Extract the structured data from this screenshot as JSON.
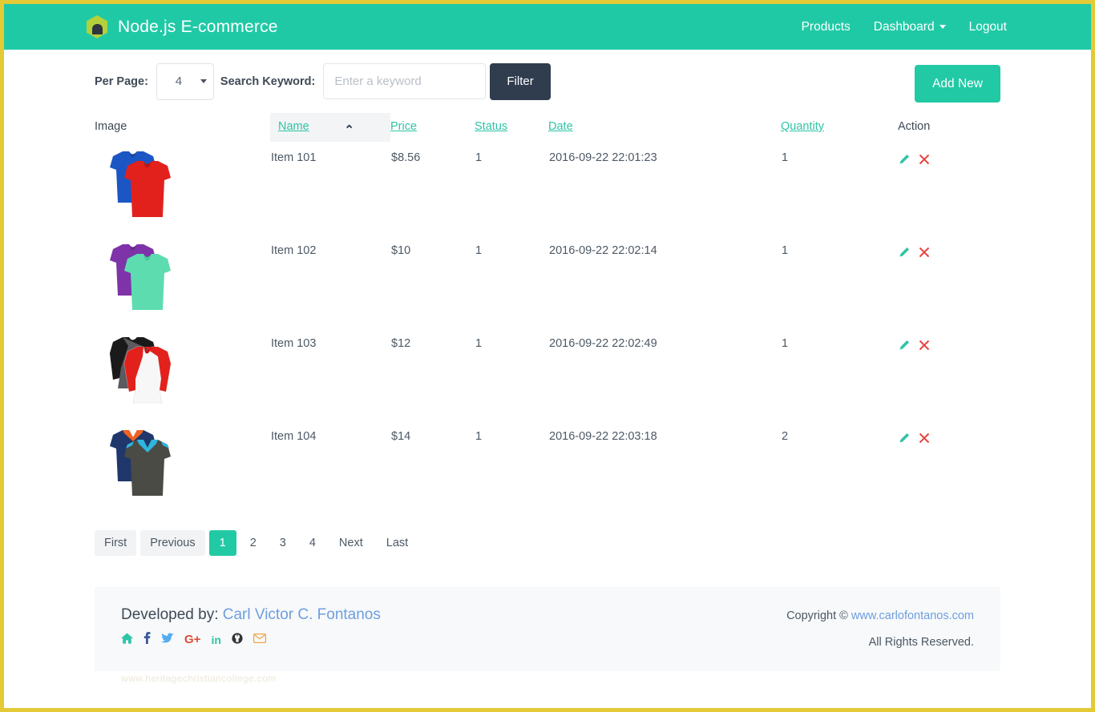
{
  "navbar": {
    "brand": "Node.js E-commerce",
    "logo_icon": "nodejs-hexagon-icon",
    "bg_color": "#20c9a6",
    "links": [
      {
        "label": "Products",
        "name": "products"
      },
      {
        "label": "Dashboard",
        "name": "dashboard",
        "has_caret": true
      },
      {
        "label": "Logout",
        "name": "logout"
      }
    ]
  },
  "toolbar": {
    "per_page_label": "Per Page:",
    "per_page_value": "4",
    "search_label": "Search Keyword:",
    "search_value": "",
    "search_placeholder": "Enter a keyword",
    "filter_label": "Filter",
    "add_new_label": "Add New"
  },
  "table": {
    "headers": [
      {
        "label": "Image",
        "sortable": false,
        "sorted": false
      },
      {
        "label": "Name",
        "sortable": true,
        "sorted": true,
        "direction": "asc"
      },
      {
        "label": "Price",
        "sortable": true,
        "sorted": false
      },
      {
        "label": "Status",
        "sortable": true,
        "sorted": false
      },
      {
        "label": "Date",
        "sortable": true,
        "sorted": false
      },
      {
        "label": "Quantity",
        "sortable": true,
        "sorted": false
      },
      {
        "label": "Action",
        "sortable": false,
        "sorted": false
      }
    ],
    "sort_indicator": "⌃",
    "rows": [
      {
        "image": "tshirt-blue-red",
        "name": "Item 101",
        "price": "$8.56",
        "status": "1",
        "date": "2016-09-22 22:01:23",
        "quantity": "1"
      },
      {
        "image": "tshirt-purple-mint",
        "name": "Item 102",
        "price": "$10",
        "status": "1",
        "date": "2016-09-22 22:02:14",
        "quantity": "1"
      },
      {
        "image": "raglan-black-red-white",
        "name": "Item 103",
        "price": "$12",
        "status": "1",
        "date": "2016-09-22 22:02:49",
        "quantity": "1"
      },
      {
        "image": "vneck-navy-gray",
        "name": "Item 104",
        "price": "$14",
        "status": "1",
        "date": "2016-09-22 22:03:18",
        "quantity": "2"
      }
    ],
    "action_icons": {
      "edit": "pencil-icon",
      "delete": "delete-x-icon"
    }
  },
  "pagination": {
    "first": "First",
    "previous": "Previous",
    "pages": [
      "1",
      "2",
      "3",
      "4"
    ],
    "active_page": "1",
    "next": "Next",
    "last": "Last"
  },
  "footer": {
    "developed_by_label": "Developed by:",
    "developer_name": "Carl Victor C. Fontanos",
    "social_icons": [
      {
        "name": "home-icon",
        "glyph": "⌂",
        "color": "#2ec4a6"
      },
      {
        "name": "facebook-icon",
        "glyph": "f",
        "color": "#3b5998"
      },
      {
        "name": "twitter-icon",
        "glyph": "ᵗ",
        "color": "#55acee"
      },
      {
        "name": "google-plus-icon",
        "glyph": "G+",
        "color": "#dd4b39"
      },
      {
        "name": "linkedin-icon",
        "glyph": "in",
        "color": "#2ec4a6"
      },
      {
        "name": "github-icon",
        "glyph": "Ⓘ",
        "color": "#333333"
      },
      {
        "name": "envelope-icon",
        "glyph": "✉",
        "color": "#f0a44a"
      }
    ],
    "copyright_label": "Copyright ©",
    "copyright_link": "www.carlofontanos.com",
    "rights": "All Rights Reserved.",
    "watermark": "www.heritagechristiancollege.com"
  },
  "colors": {
    "accent": "#20c9a6",
    "dark": "#2f3d4e",
    "link": "#2ec4a6",
    "page_border": "#e3ca36"
  }
}
